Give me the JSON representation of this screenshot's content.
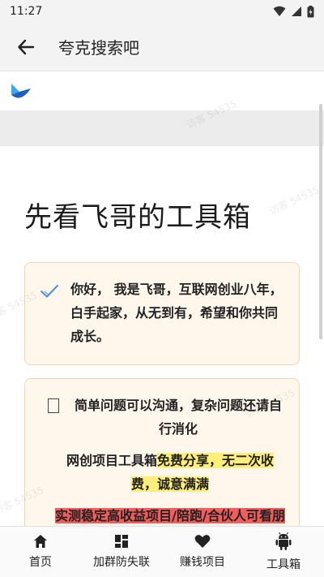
{
  "status": {
    "time": "11:27"
  },
  "app_bar": {
    "title": "夸克搜索吧"
  },
  "page": {
    "heading": "先看飞哥的工具箱"
  },
  "card1": {
    "text": "你好， 我是飞哥，互联网创业八年，白手起家，从无到有，希望和你共同成长。"
  },
  "card2": {
    "line1": "简单问题可以沟通，复杂问题还请自行消化",
    "line2_prefix": "网创项目工具箱",
    "line2_highlight": "免费分享，无二次收费，诚意满满",
    "line3_highlight": "实测稳定高收益项目/陪跑/合伙人可看朋友圈（收费）"
  },
  "watermark": {
    "text": "访客 54535"
  },
  "bottom_nav": {
    "items": [
      {
        "label": "首页",
        "icon": "home-icon"
      },
      {
        "label": "加群防失联",
        "icon": "grid-icon"
      },
      {
        "label": "赚钱项目",
        "icon": "heart-icon"
      },
      {
        "label": "工具箱",
        "icon": "android-icon"
      }
    ]
  },
  "colors": {
    "card_bg": "#fff6ec",
    "card_border": "#f2d7b6",
    "highlight_yellow": "#ffef7a",
    "highlight_red": "#f25c5c",
    "check_blue": "#4a90d9"
  }
}
